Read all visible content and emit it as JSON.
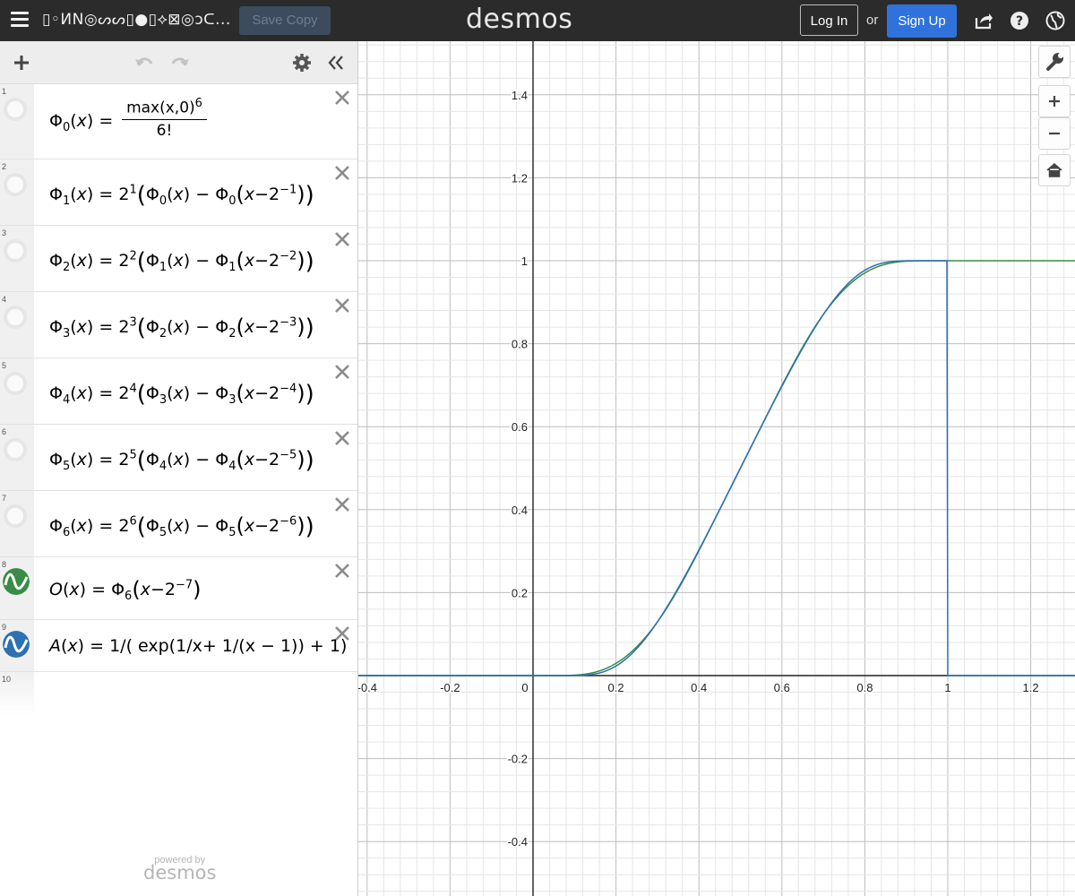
{
  "header": {
    "graph_title": "▯◦ИN◎ᔕᔕ▯●▯⟡⊠◎ↄᑕ...",
    "save_copy_label": "Save Copy",
    "logo": "desmos",
    "login_label": "Log In",
    "or_label": "or",
    "signup_label": "Sign Up",
    "icons": [
      "hamburger-icon",
      "share-icon",
      "help-icon",
      "globe-icon"
    ]
  },
  "toolbar": {
    "icons": [
      "add-icon",
      "undo-icon",
      "redo-icon",
      "settings-icon",
      "collapse-icon"
    ]
  },
  "expressions": [
    {
      "index": "1",
      "color": null,
      "hidden": true
    },
    {
      "index": "2",
      "color": null,
      "hidden": true
    },
    {
      "index": "3",
      "color": null,
      "hidden": true
    },
    {
      "index": "4",
      "color": null,
      "hidden": true
    },
    {
      "index": "5",
      "color": null,
      "hidden": true
    },
    {
      "index": "6",
      "color": null,
      "hidden": true
    },
    {
      "index": "7",
      "color": null,
      "hidden": true
    },
    {
      "index": "8",
      "color": "#388c46",
      "hidden": false
    },
    {
      "index": "9",
      "color": "#2d70b3",
      "hidden": false
    },
    {
      "index": "10"
    }
  ],
  "expression_text": {
    "phi": "Φ",
    "x": "x",
    "max_x0": "max(x,0)",
    "six": "6",
    "six_fact": "6!",
    "two": "2",
    "minus": "−",
    "e1_sub": "0",
    "e1_eq": "=",
    "rows": [
      {
        "lhs_sub": "1",
        "pow": "1",
        "rhs_sub": "0",
        "exp": "−1"
      },
      {
        "lhs_sub": "2",
        "pow": "2",
        "rhs_sub": "1",
        "exp": "−2"
      },
      {
        "lhs_sub": "3",
        "pow": "3",
        "rhs_sub": "2",
        "exp": "−3"
      },
      {
        "lhs_sub": "4",
        "pow": "4",
        "rhs_sub": "3",
        "exp": "−4"
      },
      {
        "lhs_sub": "5",
        "pow": "5",
        "rhs_sub": "4",
        "exp": "−5"
      },
      {
        "lhs_sub": "6",
        "pow": "6",
        "rhs_sub": "5",
        "exp": "−6"
      }
    ],
    "o_name": "O",
    "o_sub": "6",
    "o_exp": "−7",
    "a_name": "A",
    "a_rhs": "= 1/( exp(1/x+ 1/(x − 1)) + 1)"
  },
  "footer": {
    "powered_by": "powered by",
    "brand": "desmos"
  },
  "graph": {
    "x_ticks": [
      "-0.4",
      "-0.2",
      "0",
      "0.2",
      "0.4",
      "0.6",
      "0.8",
      "1",
      "1.2"
    ],
    "y_ticks": [
      "1.4",
      "1.2",
      "1",
      "0.8",
      "0.6",
      "0.4",
      "0.2",
      "-0.2",
      "-0.4"
    ],
    "buttons": [
      "wrench-icon",
      "zoom-in-icon",
      "zoom-out-icon",
      "home-icon"
    ],
    "curve_colors": {
      "O": "#388c46",
      "A": "#2d70b3"
    }
  }
}
